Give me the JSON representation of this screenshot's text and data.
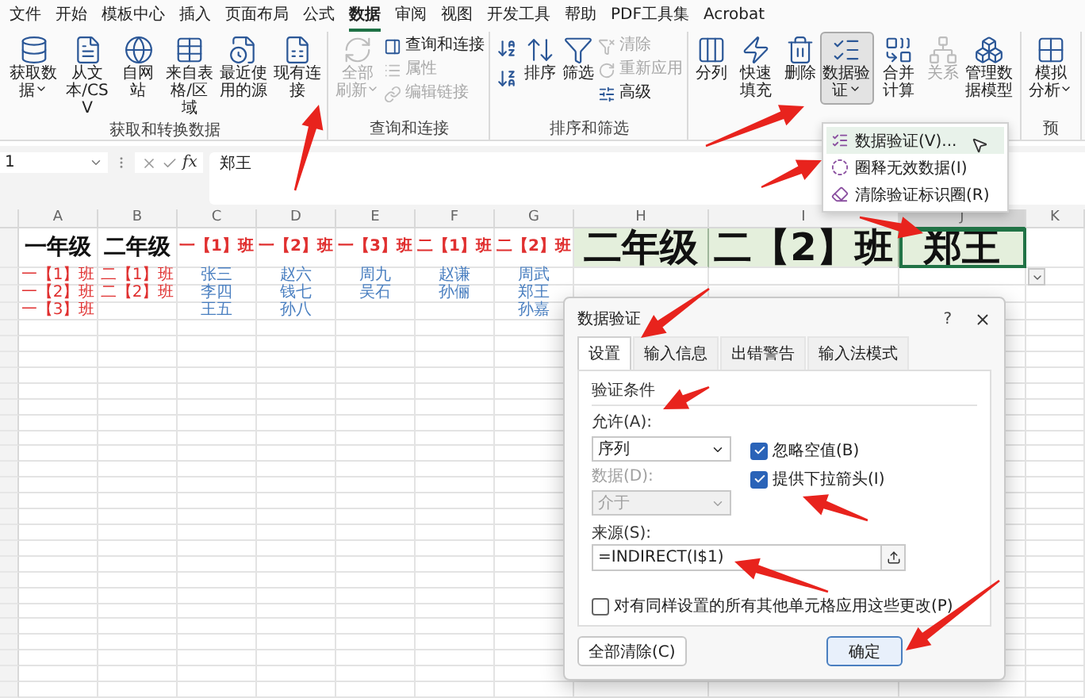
{
  "menu_tabs": [
    {
      "label": "文件",
      "selected": false
    },
    {
      "label": "开始",
      "selected": false
    },
    {
      "label": "模板中心",
      "selected": false
    },
    {
      "label": "插入",
      "selected": false
    },
    {
      "label": "页面布局",
      "selected": false
    },
    {
      "label": "公式",
      "selected": false
    },
    {
      "label": "数据",
      "selected": true
    },
    {
      "label": "审阅",
      "selected": false
    },
    {
      "label": "视图",
      "selected": false
    },
    {
      "label": "开发工具",
      "selected": false
    },
    {
      "label": "帮助",
      "selected": false
    },
    {
      "label": "PDF工具集",
      "selected": false
    },
    {
      "label": "Acrobat",
      "selected": false
    }
  ],
  "ribbon": {
    "groups": [
      {
        "label": "获取和转换数据",
        "kind": "plain",
        "buttons": [
          {
            "label": "获取数据",
            "kind": "large",
            "caret": true,
            "disabled": false,
            "pressed": false
          },
          {
            "label": "从文本/CSV",
            "kind": "large",
            "caret": false,
            "disabled": false,
            "pressed": false
          },
          {
            "label": "自网站",
            "kind": "large",
            "caret": false,
            "disabled": false,
            "pressed": false
          },
          {
            "label": "来自表格/区域",
            "kind": "large",
            "caret": false,
            "disabled": false,
            "pressed": false
          },
          {
            "label": "最近使用的源",
            "kind": "large",
            "caret": false,
            "disabled": false,
            "pressed": false
          },
          {
            "label": "现有连接",
            "kind": "large",
            "caret": false,
            "disabled": false,
            "pressed": false
          }
        ]
      },
      {
        "label": "查询和连接",
        "kind": "plain",
        "buttons": [
          {
            "label": "全部刷新",
            "kind": "large",
            "caret": true,
            "disabled": true,
            "pressed": false
          },
          {
            "label": "查询和连接",
            "kind": "small",
            "caret": false,
            "disabled": false,
            "pressed": false
          },
          {
            "label": "属性",
            "kind": "small",
            "caret": false,
            "disabled": true,
            "pressed": false
          },
          {
            "label": "编辑链接",
            "kind": "small",
            "caret": false,
            "disabled": true,
            "pressed": false
          }
        ]
      },
      {
        "label": "排序和筛选",
        "kind": "sort",
        "buttons": [
          {
            "label": "排序",
            "kind": "large",
            "caret": false,
            "disabled": false,
            "pressed": false
          },
          {
            "label": "筛选",
            "kind": "large",
            "caret": false,
            "disabled": false,
            "pressed": false
          },
          {
            "label": "清除",
            "kind": "small",
            "caret": false,
            "disabled": true,
            "pressed": false
          },
          {
            "label": "重新应用",
            "kind": "small",
            "caret": false,
            "disabled": true,
            "pressed": false
          },
          {
            "label": "高级",
            "kind": "small",
            "caret": false,
            "disabled": false,
            "pressed": false
          }
        ]
      },
      {
        "kind": "plain",
        "buttons": [
          {
            "label": "分列",
            "kind": "large",
            "caret": false,
            "disabled": false,
            "pressed": false
          },
          {
            "label": "快速填充",
            "kind": "large",
            "caret": false,
            "disabled": false,
            "pressed": false
          },
          {
            "label": "删除",
            "kind": "large",
            "caret": false,
            "disabled": false,
            "pressed": false
          },
          {
            "label": "数据验证",
            "kind": "large",
            "caret": true,
            "disabled": false,
            "pressed": true
          },
          {
            "label": "合并计算",
            "kind": "large",
            "caret": false,
            "disabled": false,
            "pressed": false
          },
          {
            "label": "关系",
            "kind": "large",
            "caret": false,
            "disabled": true,
            "pressed": false
          },
          {
            "label": "管理数据模型",
            "kind": "large",
            "caret": false,
            "disabled": false,
            "pressed": false
          }
        ]
      },
      {
        "label": "预",
        "kind": "plain",
        "buttons": [
          {
            "label": "模拟分析",
            "kind": "large",
            "caret": true,
            "disabled": false,
            "pressed": false
          }
        ]
      }
    ]
  },
  "validation_menu": {
    "items": [
      {
        "label": "数据验证(V)...",
        "selected": true
      },
      {
        "label": "圈释无效数据(I)",
        "selected": false
      },
      {
        "label": "清除验证标识圈(R)",
        "selected": false
      }
    ]
  },
  "formula_bar": {
    "name_box": "1",
    "function_label": "fx",
    "formula": "郑王"
  },
  "sheet": {
    "columns": [
      {
        "label": "A",
        "selected": false
      },
      {
        "label": "B",
        "selected": false
      },
      {
        "label": "C",
        "selected": false
      },
      {
        "label": "D",
        "selected": false
      },
      {
        "label": "E",
        "selected": false
      },
      {
        "label": "F",
        "selected": false
      },
      {
        "label": "G",
        "selected": false
      },
      {
        "label": "H",
        "selected": false
      },
      {
        "label": "I",
        "selected": false
      },
      {
        "label": "J",
        "selected": true
      },
      {
        "label": "K",
        "selected": false
      }
    ],
    "active_cell_dropdown": true,
    "rows": [
      [
        {
          "text": "一年级",
          "color": "#111111",
          "highlighted": false,
          "selected": false
        },
        {
          "text": "二年级",
          "color": "#111111",
          "highlighted": false,
          "selected": false
        },
        {
          "text": "一【1】班",
          "color": "#e03030",
          "highlighted": false,
          "selected": false
        },
        {
          "text": "一【2】班",
          "color": "#e03030",
          "highlighted": false,
          "selected": false
        },
        {
          "text": "一【3】班",
          "color": "#e03030",
          "highlighted": false,
          "selected": false
        },
        {
          "text": "二【1】班",
          "color": "#e03030",
          "highlighted": false,
          "selected": false
        },
        {
          "text": "二【2】班",
          "color": "#e03030",
          "highlighted": false,
          "selected": false
        },
        {
          "text": "二年级",
          "color": "#111111",
          "highlighted": true,
          "selected": false
        },
        {
          "text": "二【2】班",
          "color": "#111111",
          "highlighted": true,
          "selected": false
        },
        {
          "text": "郑王",
          "color": "#111111",
          "highlighted": true,
          "selected": true
        }
      ],
      [
        {
          "text": "一【1】班",
          "color": "#e03030"
        },
        {
          "text": "二【1】班",
          "color": "#e03030"
        },
        {
          "text": "张三",
          "color": "#4a7fc0"
        },
        {
          "text": "赵六",
          "color": "#4a7fc0"
        },
        {
          "text": "周九",
          "color": "#4a7fc0"
        },
        {
          "text": "赵谦",
          "color": "#4a7fc0"
        },
        {
          "text": "周武",
          "color": "#4a7fc0"
        }
      ],
      [
        {
          "text": "一【2】班",
          "color": "#e03030"
        },
        {
          "text": "二【2】班",
          "color": "#e03030"
        },
        {
          "text": "李四",
          "color": "#4a7fc0"
        },
        {
          "text": "钱七",
          "color": "#4a7fc0"
        },
        {
          "text": "吴石",
          "color": "#4a7fc0"
        },
        {
          "text": "孙俪",
          "color": "#4a7fc0"
        },
        {
          "text": "郑王",
          "color": "#4a7fc0"
        }
      ],
      [
        {
          "text": "一【3】班",
          "color": "#e03030"
        },
        null,
        {
          "text": "王五",
          "color": "#4a7fc0"
        },
        {
          "text": "孙八",
          "color": "#4a7fc0"
        },
        null,
        null,
        {
          "text": "孙嘉",
          "color": "#4a7fc0"
        }
      ]
    ]
  },
  "dialog": {
    "title": "数据验证",
    "help": "?",
    "tabs": [
      {
        "label": "设置",
        "selected": true
      },
      {
        "label": "输入信息",
        "selected": false
      },
      {
        "label": "出错警告",
        "selected": false
      },
      {
        "label": "输入法模式",
        "selected": false
      }
    ],
    "section": "验证条件",
    "allow": {
      "label": "允许(A):",
      "value": "序列",
      "disabled": false
    },
    "data": {
      "label": "数据(D):",
      "value": "介于",
      "disabled": true
    },
    "checks": [
      {
        "label": "忽略空值(B)",
        "checked": true
      },
      {
        "label": "提供下拉箭头(I)",
        "checked": true
      }
    ],
    "source": {
      "label": "来源(S):",
      "value": "=INDIRECT(I$1)"
    },
    "apply_all": {
      "label": "对有同样设置的所有其他单元格应用这些更改(P)",
      "checked": false
    },
    "buttons": [
      {
        "label": "全部清除(C)",
        "kind": "secondary"
      },
      {
        "label": "确定",
        "kind": "primary"
      }
    ]
  }
}
